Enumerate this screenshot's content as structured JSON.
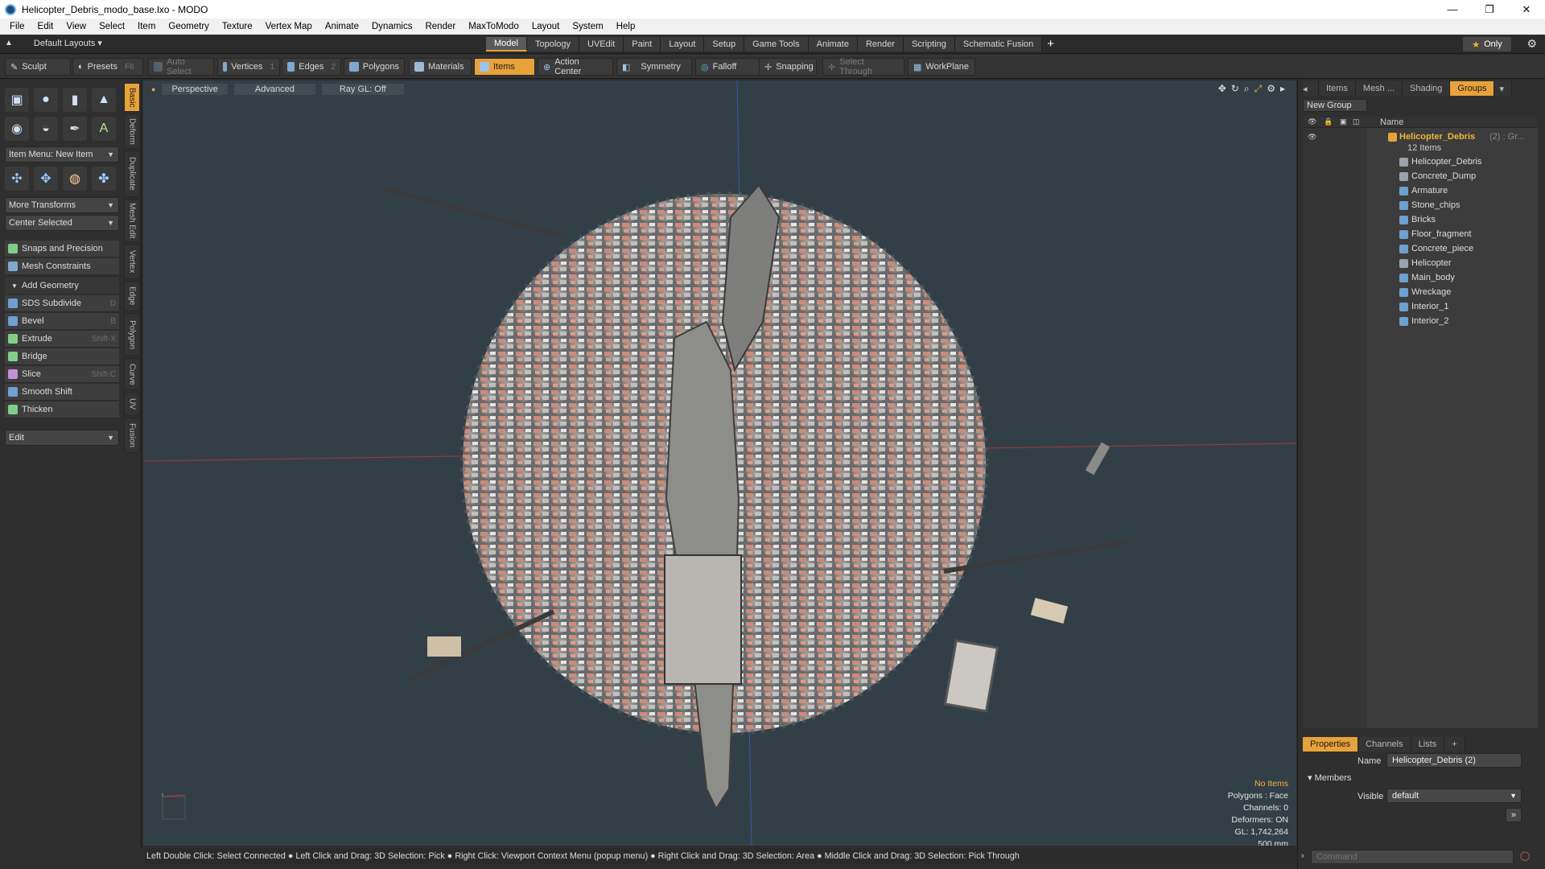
{
  "window": {
    "title": "Helicopter_Debris_modo_base.lxo - MODO",
    "minimize": "—",
    "maximize": "❐",
    "close": "✕"
  },
  "menu": [
    "File",
    "Edit",
    "View",
    "Select",
    "Item",
    "Geometry",
    "Texture",
    "Vertex Map",
    "Animate",
    "Dynamics",
    "Render",
    "MaxToModo",
    "Layout",
    "System",
    "Help"
  ],
  "layoutbar": {
    "layouts_label": "Default Layouts ▾",
    "tabs": [
      "Model",
      "Topology",
      "UVEdit",
      "Paint",
      "Layout",
      "Setup",
      "Game Tools",
      "Animate",
      "Render",
      "Scripting",
      "Schematic Fusion"
    ],
    "active_tab": "Model",
    "plus": "+",
    "only": "Only"
  },
  "toolbar": {
    "sculpt": "Sculpt",
    "presets": "Presets",
    "presets_key": "F6",
    "auto_select": "Auto Select",
    "vertices": "Vertices",
    "vertices_count": "1",
    "edges": "Edges",
    "edges_count": "2",
    "polygons": "Polygons",
    "materials": "Materials",
    "items": "Items",
    "action_center": "Action Center",
    "symmetry": "Symmetry",
    "falloff": "Falloff",
    "snapping": "Snapping",
    "select_through": "Select Through",
    "workplane": "WorkPlane"
  },
  "leftpanel": {
    "vtabs": [
      "Basic",
      "Deform",
      "Duplicate",
      "Mesh Edit",
      "Vertex",
      "Edge",
      "Polygon",
      "Curve",
      "UV",
      "Fusion"
    ],
    "item_menu": "Item Menu: New Item",
    "more_transforms": "More Transforms",
    "center_selected": "Center Selected",
    "snaps": "Snaps and Precision",
    "mesh_constraints": "Mesh Constraints",
    "add_geometry": "Add Geometry",
    "tools": [
      {
        "label": "SDS Subdivide",
        "key": "D"
      },
      {
        "label": "Bevel",
        "key": "B"
      },
      {
        "label": "Extrude",
        "key": "Shift-X"
      },
      {
        "label": "Bridge",
        "key": ""
      },
      {
        "label": "Slice",
        "key": "Shift-C"
      },
      {
        "label": "Smooth Shift",
        "key": ""
      },
      {
        "label": "Thicken",
        "key": ""
      }
    ],
    "edit": "Edit"
  },
  "viewport": {
    "perspective": "Perspective",
    "advanced": "Advanced",
    "raygl": "Ray GL: Off",
    "info": [
      "No Items",
      "Polygons : Face",
      "Channels: 0",
      "Deformers: ON",
      "GL: 1,742,264",
      "500 mm"
    ]
  },
  "statusbar": "Left Double Click: Select Connected ● Left Click and Drag: 3D Selection: Pick ● Right Click: Viewport Context Menu (popup menu) ● Right Click and Drag: 3D Selection: Area ● Middle Click and Drag: 3D Selection: Pick Through",
  "rightpanel": {
    "tabs": [
      "Items",
      "Mesh ...",
      "Shading",
      "Groups"
    ],
    "active_tab": "Groups",
    "new_group": "New Group",
    "col_name": "Name",
    "group_name": "Helicopter_Debris",
    "group_suffix": "(2) : Gr...",
    "group_count": "12 Items",
    "items": [
      "Helicopter_Debris",
      "Concrete_Dump",
      "Armature",
      "Stone_chips",
      "Bricks",
      "Floor_fragment",
      "Concrete_piece",
      "Helicopter",
      "Main_body",
      "Wreckage",
      "Interior_1",
      "Interior_2"
    ],
    "prop_tabs": [
      "Properties",
      "Channels",
      "Lists"
    ],
    "name_label": "Name",
    "name_value": "Helicopter_Debris (2)",
    "members": "Members",
    "visible_label": "Visible",
    "visible_value": "default",
    "command_placeholder": "Command"
  },
  "colors": {
    "accent": "#e8a23a",
    "viewport_bg": "#333f47",
    "panel_bg": "#2f2f2f"
  }
}
